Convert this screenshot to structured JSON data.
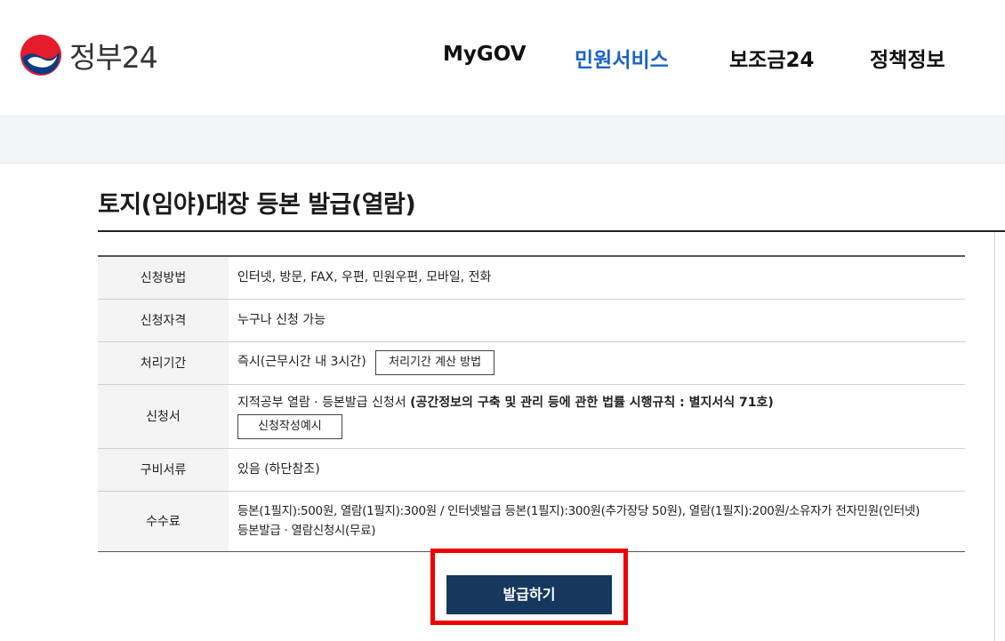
{
  "header": {
    "logo_text": "정부24",
    "nav": [
      {
        "label": "MyGOV",
        "active": false
      },
      {
        "label": "민원서비스",
        "active": true
      },
      {
        "label": "보조금24",
        "active": false
      },
      {
        "label": "정책정보",
        "active": false
      }
    ]
  },
  "page": {
    "title": "토지(임야)대장 등본 발급(열람)"
  },
  "info_table": {
    "rows": [
      {
        "label": "신청방법",
        "value": "인터넷, 방문, FAX, 우편, 민원우편, 모바일, 전화"
      },
      {
        "label": "신청자격",
        "value": "누구나 신청 가능"
      },
      {
        "label": "처리기간",
        "value": "즉시(근무시간 내 3시간)",
        "button": "처리기간 계산 방법"
      },
      {
        "label": "신청서",
        "value_normal": "지적공부 열람 · 등본발급 신청서 ",
        "value_bold": "(공간정보의 구축 및 관리 등에 관한 법률 시행규칙 : 별지서식 71호)",
        "button": "신청작성예시"
      },
      {
        "label": "구비서류",
        "value": "있음 (하단참조)"
      },
      {
        "label": "수수료",
        "value_line1": "등본(1필지):500원, 열람(1필지):300원 / 인터넷발급 등본(1필지):300원(추가장당 50원), 열람(1필지):200원/소유자가 전자민원(인터넷)",
        "value_line2": "등본발급 · 열람신청시(무료)"
      }
    ]
  },
  "actions": {
    "issue_label": "발급하기"
  },
  "colors": {
    "accent_blue": "#1b63c6",
    "primary_button": "#16385f",
    "highlight_red": "#f00000"
  }
}
